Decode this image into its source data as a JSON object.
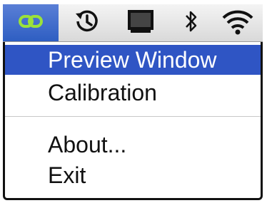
{
  "menubar": {
    "items": [
      {
        "icon": "link-icon"
      },
      {
        "icon": "time-machine-icon"
      },
      {
        "icon": "display-icon"
      },
      {
        "icon": "bluetooth-icon"
      },
      {
        "icon": "wifi-icon"
      }
    ],
    "active_color": "#2f55c4"
  },
  "menu": {
    "items": [
      {
        "label": "Preview Window",
        "highlighted": true
      },
      {
        "label": "Calibration"
      },
      {
        "label": "About..."
      },
      {
        "label": "Exit"
      }
    ]
  }
}
